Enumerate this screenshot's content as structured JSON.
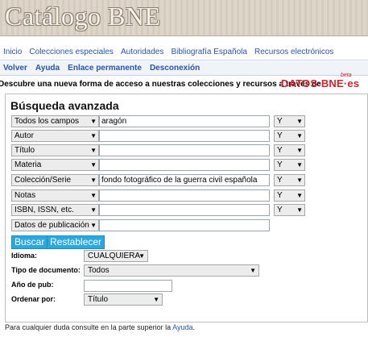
{
  "banner": {
    "title": "Catálogo BNE"
  },
  "nav_primary": [
    "Inicio",
    "Colecciones especiales",
    "Autoridades",
    "Bibliografía Española",
    "Recursos electrónicos"
  ],
  "nav_secondary": [
    "Volver",
    "Ayuda",
    "Enlace permanente",
    "Desconexión"
  ],
  "promo": {
    "text": "Descubre una nueva forma de acceso a nuestras colecciones y recursos a través de",
    "logo": "DATOS·BNE·es",
    "beta": "beta"
  },
  "search": {
    "title": "Búsqueda avanzada",
    "rows": [
      {
        "field": "Todos los campos",
        "value": "aragón",
        "op": "Y"
      },
      {
        "field": "Autor",
        "value": "",
        "op": "Y"
      },
      {
        "field": "Título",
        "value": "",
        "op": "Y"
      },
      {
        "field": "Materia",
        "value": "",
        "op": "Y"
      },
      {
        "field": "Colección/Serie",
        "value": "fondo fotográfico de la guerra civil española",
        "op": "Y"
      },
      {
        "field": "Notas",
        "value": "",
        "op": "Y"
      },
      {
        "field": "ISBN, ISSN, etc.",
        "value": "",
        "op": "Y"
      },
      {
        "field": "Datos de publicación",
        "value": "",
        "op": ""
      }
    ],
    "search_label": "Buscar",
    "reset_label": "Restablecer",
    "idioma_label": "Idioma:",
    "idioma_value": "CUALQUIERA",
    "tipo_label": "Tipo de documento:",
    "tipo_value": "Todos",
    "anio_label": "Año de pub:",
    "anio_value": "",
    "orden_label": "Ordenar por:",
    "orden_value": "Título"
  },
  "footer": {
    "text": "Para cualquier duda consulte en la parte superior la ",
    "link": "Ayuda",
    "end": "."
  },
  "icons": {
    "dropdown": "chevron-down-icon"
  },
  "colors": {
    "link": "#2a54a8",
    "button": "#2aa9e0",
    "promo_red": "#d2232a"
  }
}
